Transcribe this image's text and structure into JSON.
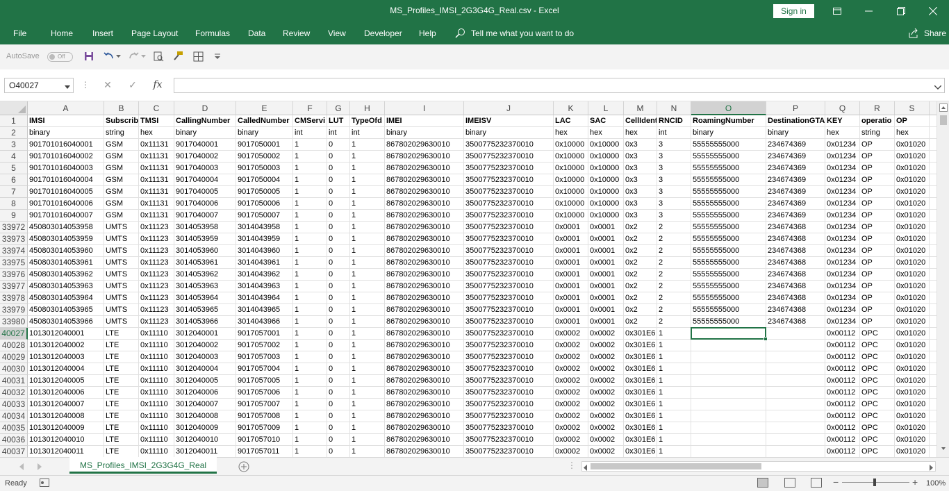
{
  "window": {
    "title": "MS_Profiles_IMSI_2G3G4G_Real.csv  -  Excel",
    "sign_in": "Sign in"
  },
  "menu": [
    "File",
    "Home",
    "Insert",
    "Page Layout",
    "Formulas",
    "Data",
    "Review",
    "View",
    "Developer",
    "Help"
  ],
  "tell_me": "Tell me what you want to do",
  "share": "Share",
  "qat": {
    "autosave": "AutoSave",
    "toggle": "Off"
  },
  "namebox": "O40027",
  "formula_value": "",
  "columns": [
    {
      "letter": "A"
    },
    {
      "letter": "B"
    },
    {
      "letter": "C"
    },
    {
      "letter": "D"
    },
    {
      "letter": "E"
    },
    {
      "letter": "F"
    },
    {
      "letter": "G"
    },
    {
      "letter": "H"
    },
    {
      "letter": "I"
    },
    {
      "letter": "J"
    },
    {
      "letter": "K"
    },
    {
      "letter": "L"
    },
    {
      "letter": "M"
    },
    {
      "letter": "N"
    },
    {
      "letter": "O"
    },
    {
      "letter": "P"
    },
    {
      "letter": "Q"
    },
    {
      "letter": "R"
    },
    {
      "letter": "S"
    }
  ],
  "rows": [
    {
      "num": "1",
      "cells": [
        "IMSI",
        "Subscribe",
        "TMSI",
        "CallingNumber",
        "CalledNumber",
        "CMServi",
        "LUT",
        "TypeOfd",
        "IMEI",
        "IMEISV",
        "LAC",
        "SAC",
        "CellIdent",
        "RNCID",
        "RoamingNumber",
        "DestinationGTA",
        "KEY",
        "operatio",
        "OP"
      ]
    },
    {
      "num": "2",
      "cells": [
        "binary",
        "string",
        "hex",
        "binary",
        "binary",
        "int",
        "int",
        "int",
        "binary",
        "binary",
        "hex",
        "hex",
        "hex",
        "int",
        "binary",
        "binary",
        "hex",
        "string",
        "hex"
      ]
    },
    {
      "num": "3",
      "cells": [
        "901701016040001",
        "GSM",
        "0x11131",
        "9017040001",
        "9017050001",
        "1",
        "0",
        "1",
        "867802029630010",
        "3500775232370010",
        "0x10000",
        "0x10000",
        "0x3",
        "3",
        "55555555000",
        "234674369",
        "0x01234",
        "OP",
        "0x01020"
      ]
    },
    {
      "num": "4",
      "cells": [
        "901701016040002",
        "GSM",
        "0x11131",
        "9017040002",
        "9017050002",
        "1",
        "0",
        "1",
        "867802029630010",
        "3500775232370010",
        "0x10000",
        "0x10000",
        "0x3",
        "3",
        "55555555000",
        "234674369",
        "0x01234",
        "OP",
        "0x01020"
      ]
    },
    {
      "num": "5",
      "cells": [
        "901701016040003",
        "GSM",
        "0x11131",
        "9017040003",
        "9017050003",
        "1",
        "0",
        "1",
        "867802029630010",
        "3500775232370010",
        "0x10000",
        "0x10000",
        "0x3",
        "3",
        "55555555000",
        "234674369",
        "0x01234",
        "OP",
        "0x01020"
      ]
    },
    {
      "num": "6",
      "cells": [
        "901701016040004",
        "GSM",
        "0x11131",
        "9017040004",
        "9017050004",
        "1",
        "0",
        "1",
        "867802029630010",
        "3500775232370010",
        "0x10000",
        "0x10000",
        "0x3",
        "3",
        "55555555000",
        "234674369",
        "0x01234",
        "OP",
        "0x01020"
      ]
    },
    {
      "num": "7",
      "cells": [
        "901701016040005",
        "GSM",
        "0x11131",
        "9017040005",
        "9017050005",
        "1",
        "0",
        "1",
        "867802029630010",
        "3500775232370010",
        "0x10000",
        "0x10000",
        "0x3",
        "3",
        "55555555000",
        "234674369",
        "0x01234",
        "OP",
        "0x01020"
      ]
    },
    {
      "num": "8",
      "cells": [
        "901701016040006",
        "GSM",
        "0x11131",
        "9017040006",
        "9017050006",
        "1",
        "0",
        "1",
        "867802029630010",
        "3500775232370010",
        "0x10000",
        "0x10000",
        "0x3",
        "3",
        "55555555000",
        "234674369",
        "0x01234",
        "OP",
        "0x01020"
      ]
    },
    {
      "num": "9",
      "cells": [
        "901701016040007",
        "GSM",
        "0x11131",
        "9017040007",
        "9017050007",
        "1",
        "0",
        "1",
        "867802029630010",
        "3500775232370010",
        "0x10000",
        "0x10000",
        "0x3",
        "3",
        "55555555000",
        "234674369",
        "0x01234",
        "OP",
        "0x01020"
      ]
    },
    {
      "num": "33972",
      "cells": [
        "450803014053958",
        "UMTS",
        "0x11123",
        "3014053958",
        "3014043958",
        "1",
        "0",
        "1",
        "867802029630010",
        "3500775232370010",
        "0x0001",
        "0x0001",
        "0x2",
        "2",
        "55555555000",
        "234674368",
        "0x01234",
        "OP",
        "0x01020"
      ]
    },
    {
      "num": "33973",
      "cells": [
        "450803014053959",
        "UMTS",
        "0x11123",
        "3014053959",
        "3014043959",
        "1",
        "0",
        "1",
        "867802029630010",
        "3500775232370010",
        "0x0001",
        "0x0001",
        "0x2",
        "2",
        "55555555000",
        "234674368",
        "0x01234",
        "OP",
        "0x01020"
      ]
    },
    {
      "num": "33974",
      "cells": [
        "450803014053960",
        "UMTS",
        "0x11123",
        "3014053960",
        "3014043960",
        "1",
        "0",
        "1",
        "867802029630010",
        "3500775232370010",
        "0x0001",
        "0x0001",
        "0x2",
        "2",
        "55555555000",
        "234674368",
        "0x01234",
        "OP",
        "0x01020"
      ]
    },
    {
      "num": "33975",
      "cells": [
        "450803014053961",
        "UMTS",
        "0x11123",
        "3014053961",
        "3014043961",
        "1",
        "0",
        "1",
        "867802029630010",
        "3500775232370010",
        "0x0001",
        "0x0001",
        "0x2",
        "2",
        "55555555000",
        "234674368",
        "0x01234",
        "OP",
        "0x01020"
      ]
    },
    {
      "num": "33976",
      "cells": [
        "450803014053962",
        "UMTS",
        "0x11123",
        "3014053962",
        "3014043962",
        "1",
        "0",
        "1",
        "867802029630010",
        "3500775232370010",
        "0x0001",
        "0x0001",
        "0x2",
        "2",
        "55555555000",
        "234674368",
        "0x01234",
        "OP",
        "0x01020"
      ]
    },
    {
      "num": "33977",
      "cells": [
        "450803014053963",
        "UMTS",
        "0x11123",
        "3014053963",
        "3014043963",
        "1",
        "0",
        "1",
        "867802029630010",
        "3500775232370010",
        "0x0001",
        "0x0001",
        "0x2",
        "2",
        "55555555000",
        "234674368",
        "0x01234",
        "OP",
        "0x01020"
      ]
    },
    {
      "num": "33978",
      "cells": [
        "450803014053964",
        "UMTS",
        "0x11123",
        "3014053964",
        "3014043964",
        "1",
        "0",
        "1",
        "867802029630010",
        "3500775232370010",
        "0x0001",
        "0x0001",
        "0x2",
        "2",
        "55555555000",
        "234674368",
        "0x01234",
        "OP",
        "0x01020"
      ]
    },
    {
      "num": "33979",
      "cells": [
        "450803014053965",
        "UMTS",
        "0x11123",
        "3014053965",
        "3014043965",
        "1",
        "0",
        "1",
        "867802029630010",
        "3500775232370010",
        "0x0001",
        "0x0001",
        "0x2",
        "2",
        "55555555000",
        "234674368",
        "0x01234",
        "OP",
        "0x01020"
      ]
    },
    {
      "num": "33980",
      "cells": [
        "450803014053966",
        "UMTS",
        "0x11123",
        "3014053966",
        "3014043966",
        "1",
        "0",
        "1",
        "867802029630010",
        "3500775232370010",
        "0x0001",
        "0x0001",
        "0x2",
        "2",
        "55555555000",
        "234674368",
        "0x01234",
        "OP",
        "0x01020"
      ]
    },
    {
      "num": "40027",
      "cells": [
        "1013012040001",
        "LTE",
        "0x11110",
        "3012040001",
        "9017057001",
        "1",
        "0",
        "1",
        "867802029630010",
        "3500775232370010",
        "0x0002",
        "0x0002",
        "0x301E6",
        "1",
        "",
        "",
        "0x00112",
        "OPC",
        "0x01020"
      ]
    },
    {
      "num": "40028",
      "cells": [
        "1013012040002",
        "LTE",
        "0x11110",
        "3012040002",
        "9017057002",
        "1",
        "0",
        "1",
        "867802029630010",
        "3500775232370010",
        "0x0002",
        "0x0002",
        "0x301E6",
        "1",
        "",
        "",
        "0x00112",
        "OPC",
        "0x01020"
      ]
    },
    {
      "num": "40029",
      "cells": [
        "1013012040003",
        "LTE",
        "0x11110",
        "3012040003",
        "9017057003",
        "1",
        "0",
        "1",
        "867802029630010",
        "3500775232370010",
        "0x0002",
        "0x0002",
        "0x301E6",
        "1",
        "",
        "",
        "0x00112",
        "OPC",
        "0x01020"
      ]
    },
    {
      "num": "40030",
      "cells": [
        "1013012040004",
        "LTE",
        "0x11110",
        "3012040004",
        "9017057004",
        "1",
        "0",
        "1",
        "867802029630010",
        "3500775232370010",
        "0x0002",
        "0x0002",
        "0x301E6",
        "1",
        "",
        "",
        "0x00112",
        "OPC",
        "0x01020"
      ]
    },
    {
      "num": "40031",
      "cells": [
        "1013012040005",
        "LTE",
        "0x11110",
        "3012040005",
        "9017057005",
        "1",
        "0",
        "1",
        "867802029630010",
        "3500775232370010",
        "0x0002",
        "0x0002",
        "0x301E6",
        "1",
        "",
        "",
        "0x00112",
        "OPC",
        "0x01020"
      ]
    },
    {
      "num": "40032",
      "cells": [
        "1013012040006",
        "LTE",
        "0x11110",
        "3012040006",
        "9017057006",
        "1",
        "0",
        "1",
        "867802029630010",
        "3500775232370010",
        "0x0002",
        "0x0002",
        "0x301E6",
        "1",
        "",
        "",
        "0x00112",
        "OPC",
        "0x01020"
      ]
    },
    {
      "num": "40033",
      "cells": [
        "1013012040007",
        "LTE",
        "0x11110",
        "3012040007",
        "9017057007",
        "1",
        "0",
        "1",
        "867802029630010",
        "3500775232370010",
        "0x0002",
        "0x0002",
        "0x301E6",
        "1",
        "",
        "",
        "0x00112",
        "OPC",
        "0x01020"
      ]
    },
    {
      "num": "40034",
      "cells": [
        "1013012040008",
        "LTE",
        "0x11110",
        "3012040008",
        "9017057008",
        "1",
        "0",
        "1",
        "867802029630010",
        "3500775232370010",
        "0x0002",
        "0x0002",
        "0x301E6",
        "1",
        "",
        "",
        "0x00112",
        "OPC",
        "0x01020"
      ]
    },
    {
      "num": "40035",
      "cells": [
        "1013012040009",
        "LTE",
        "0x11110",
        "3012040009",
        "9017057009",
        "1",
        "0",
        "1",
        "867802029630010",
        "3500775232370010",
        "0x0002",
        "0x0002",
        "0x301E6",
        "1",
        "",
        "",
        "0x00112",
        "OPC",
        "0x01020"
      ]
    },
    {
      "num": "40036",
      "cells": [
        "1013012040010",
        "LTE",
        "0x11110",
        "3012040010",
        "9017057010",
        "1",
        "0",
        "1",
        "867802029630010",
        "3500775232370010",
        "0x0002",
        "0x0002",
        "0x301E6",
        "1",
        "",
        "",
        "0x00112",
        "OPC",
        "0x01020"
      ]
    },
    {
      "num": "40037",
      "cells": [
        "1013012040011",
        "LTE",
        "0x11110",
        "3012040011",
        "9017057011",
        "1",
        "0",
        "1",
        "867802029630010",
        "3500775232370010",
        "0x0002",
        "0x0002",
        "0x301E6",
        "1",
        "",
        "",
        "0x00112",
        "OPC",
        "0x01020"
      ]
    }
  ],
  "active_cell": {
    "col": "O",
    "row": "40027"
  },
  "sheet_tab": "MS_Profiles_IMSI_2G3G4G_Real",
  "status": "Ready",
  "zoom": "100%",
  "colors": {
    "accent": "#217346"
  }
}
